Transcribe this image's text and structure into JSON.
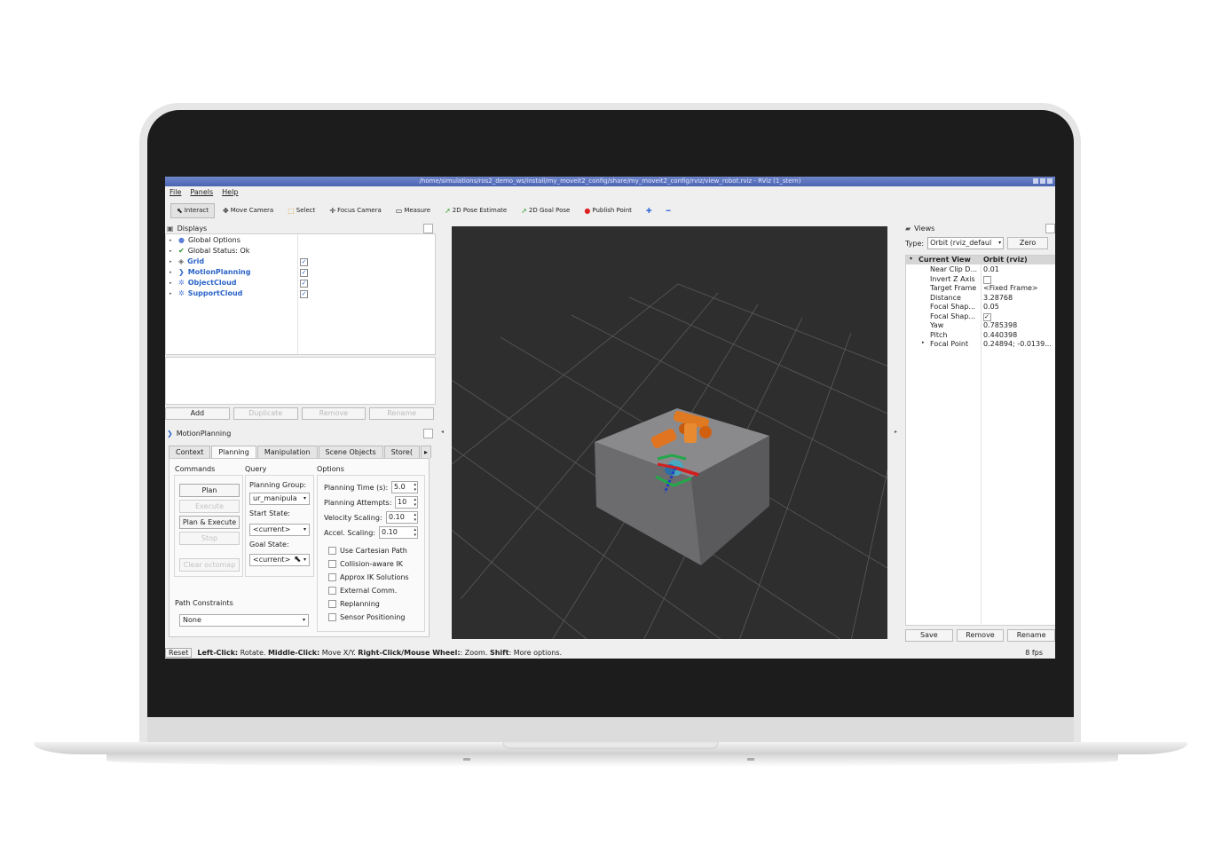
{
  "window": {
    "title": "/home/simulations/ros2_demo_ws/install/my_moveit2_config/share/my_moveit2_config/rviz/view_robot.rviz - RViz (1_stern)"
  },
  "menu": [
    "File",
    "Panels",
    "Help"
  ],
  "toolbar": [
    {
      "label": "Interact",
      "icon": "cursor-icon"
    },
    {
      "label": "Move Camera",
      "icon": "move-camera-icon"
    },
    {
      "label": "Select",
      "icon": "select-icon"
    },
    {
      "label": "Focus Camera",
      "icon": "focus-camera-icon"
    },
    {
      "label": "Measure",
      "icon": "ruler-icon"
    },
    {
      "label": "2D Pose Estimate",
      "icon": "arrow-icon"
    },
    {
      "label": "2D Goal Pose",
      "icon": "arrow-icon"
    },
    {
      "label": "Publish Point",
      "icon": "pin-icon"
    }
  ],
  "displays": {
    "title": "Displays",
    "items": [
      {
        "label": "Global Options"
      },
      {
        "label": "Global Status: Ok"
      },
      {
        "label": "Grid"
      },
      {
        "label": "MotionPlanning"
      },
      {
        "label": "ObjectCloud"
      },
      {
        "label": "SupportCloud"
      }
    ],
    "buttons": {
      "add": "Add",
      "duplicate": "Duplicate",
      "remove": "Remove",
      "rename": "Rename"
    }
  },
  "motion_planning": {
    "title": "MotionPlanning",
    "tabs": [
      "Context",
      "Planning",
      "Manipulation",
      "Scene Objects",
      "Store("
    ],
    "commands_label": "Commands",
    "query_label": "Query",
    "options_label": "Options",
    "buttons": {
      "plan": "Plan",
      "execute": "Execute",
      "plan_execute": "Plan & Execute",
      "stop": "Stop",
      "clear_octomap": "Clear octomap"
    },
    "planning_group_label": "Planning Group:",
    "planning_group_value": "ur_manipula",
    "start_state_label": "Start State:",
    "start_state_value": "<current>",
    "goal_state_label": "Goal State:",
    "goal_state_value": "<current>",
    "planning_time_label": "Planning Time (s):",
    "planning_time_value": "5.0",
    "planning_attempts_label": "Planning Attempts:",
    "planning_attempts_value": "10",
    "velocity_label": "Velocity Scaling:",
    "velocity_value": "0.10",
    "accel_label": "Accel. Scaling:",
    "accel_value": "0.10",
    "checkboxes": [
      "Use Cartesian Path",
      "Collision-aware IK",
      "Approx IK Solutions",
      "External Comm.",
      "Replanning",
      "Sensor Positioning"
    ],
    "path_constraints_label": "Path Constraints",
    "path_constraints_value": "None"
  },
  "views": {
    "title": "Views",
    "type_label": "Type:",
    "type_value": "Orbit (rviz_defaul",
    "zero": "Zero",
    "header_key": "Current View",
    "header_value": "Orbit (rviz)",
    "rows": [
      {
        "k": "Near Clip D...",
        "v": "0.01"
      },
      {
        "k": "Invert Z Axis",
        "v": ""
      },
      {
        "k": "Target Frame",
        "v": "<Fixed Frame>"
      },
      {
        "k": "Distance",
        "v": "3.28768"
      },
      {
        "k": "Focal Shap...",
        "v": "0.05"
      },
      {
        "k": "Focal Shap...",
        "v": "✓"
      },
      {
        "k": "Yaw",
        "v": "0.785398"
      },
      {
        "k": "Pitch",
        "v": "0.440398"
      },
      {
        "k": "Focal Point",
        "v": "0.24894; -0.0139..."
      }
    ],
    "buttons": {
      "save": "Save",
      "remove": "Remove",
      "rename": "Rename"
    }
  },
  "status": {
    "reset": "Reset",
    "hint_b1": "Left-Click:",
    "hint_t1": " Rotate. ",
    "hint_b2": "Middle-Click:",
    "hint_t2": " Move X/Y. ",
    "hint_b3": "Right-Click/Mouse Wheel:",
    "hint_t3": ": Zoom. ",
    "hint_b4": "Shift",
    "hint_t4": ": More options.",
    "fps": "8 fps"
  }
}
